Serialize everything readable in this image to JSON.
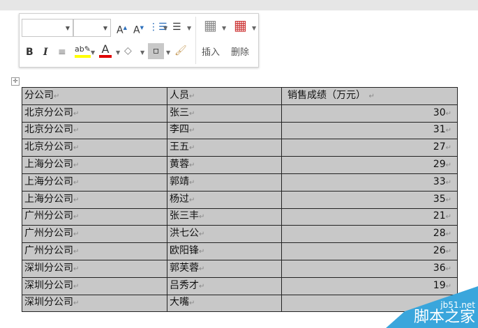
{
  "toolbar": {
    "insert_label": "插入",
    "delete_label": "删除",
    "highlight_color": "#ffff00",
    "font_color": "#e00000"
  },
  "table": {
    "headers": [
      "分公司",
      "人员",
      "销售成绩（万元）"
    ],
    "rows": [
      [
        "北京分公司",
        "张三",
        "30"
      ],
      [
        "北京分公司",
        "李四",
        "31"
      ],
      [
        "北京分公司",
        "王五",
        "27"
      ],
      [
        "上海分公司",
        "黄蓉",
        "29"
      ],
      [
        "上海分公司",
        "郭靖",
        "33"
      ],
      [
        "上海分公司",
        "杨过",
        "35"
      ],
      [
        "广州分公司",
        "张三丰",
        "21"
      ],
      [
        "广州分公司",
        "洪七公",
        "28"
      ],
      [
        "广州分公司",
        "欧阳锋",
        "26"
      ],
      [
        "深圳分公司",
        "郭芙蓉",
        "36"
      ],
      [
        "深圳分公司",
        "吕秀才",
        "19"
      ],
      [
        "深圳分公司",
        "大嘴",
        ""
      ]
    ]
  },
  "mark": "↵",
  "watermark": {
    "site": "jb51.net",
    "name": "脚本之家"
  }
}
